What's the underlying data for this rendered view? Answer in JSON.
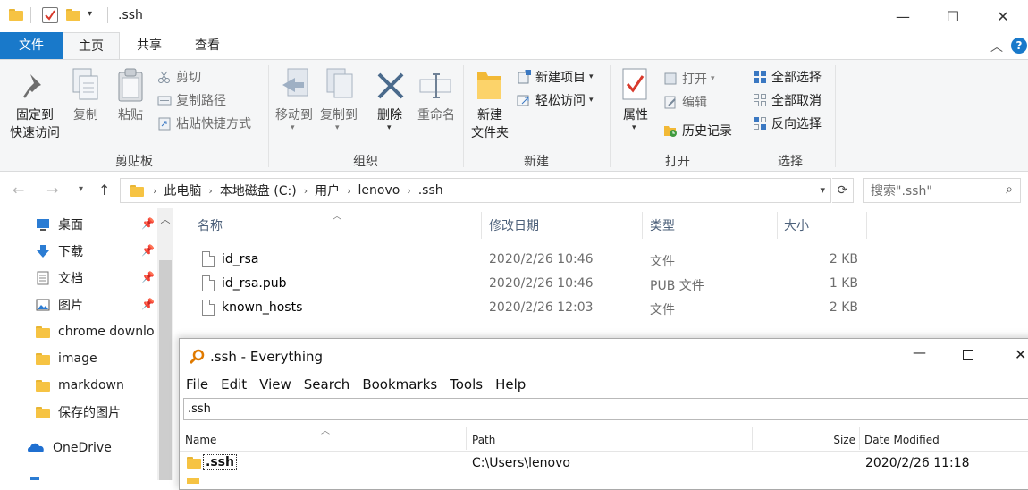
{
  "window": {
    "title": ".ssh",
    "controls": {
      "minimize": "—",
      "maximize": "☐",
      "close": "✕"
    }
  },
  "ribbon_tabs": [
    "文件",
    "主页",
    "共享",
    "查看"
  ],
  "ribbon": {
    "clipboard": {
      "pin_label": "固定到\n快速访问",
      "copy_label": "复制",
      "paste_label": "粘贴",
      "cut_label": "剪切",
      "copy_path_label": "复制路径",
      "paste_shortcut_label": "粘贴快捷方式",
      "group_label": "剪贴板"
    },
    "organize": {
      "move_to_label": "移动到",
      "copy_to_label": "复制到",
      "delete_label": "删除",
      "rename_label": "重命名",
      "group_label": "组织"
    },
    "new": {
      "new_folder_label": "新建\n文件夹",
      "new_item_label": "新建项目",
      "easy_access_label": "轻松访问",
      "group_label": "新建"
    },
    "open": {
      "properties_label": "属性",
      "open_label": "打开",
      "edit_label": "编辑",
      "history_label": "历史记录",
      "group_label": "打开"
    },
    "select": {
      "select_all_label": "全部选择",
      "select_none_label": "全部取消",
      "invert_label": "反向选择",
      "group_label": "选择"
    }
  },
  "address": {
    "breadcrumbs": [
      "此电脑",
      "本地磁盘 (C:)",
      "用户",
      "lenovo",
      ".ssh"
    ],
    "search_placeholder": "搜索\".ssh\""
  },
  "nav_pane": [
    {
      "label": "桌面",
      "icon": "desktop-icon",
      "pinned": true
    },
    {
      "label": "下载",
      "icon": "download-icon",
      "pinned": true
    },
    {
      "label": "文档",
      "icon": "documents-icon",
      "pinned": true
    },
    {
      "label": "图片",
      "icon": "pictures-icon",
      "pinned": true
    },
    {
      "label": "chrome downlo",
      "icon": "folder-icon",
      "pinned": false
    },
    {
      "label": "image",
      "icon": "folder-icon",
      "pinned": false
    },
    {
      "label": "markdown",
      "icon": "folder-icon",
      "pinned": false
    },
    {
      "label": "保存的图片",
      "icon": "folder-icon",
      "pinned": false
    },
    {
      "label": "OneDrive",
      "icon": "onedrive-icon",
      "pinned": false
    }
  ],
  "file_list": {
    "columns": [
      "名称",
      "修改日期",
      "类型",
      "大小"
    ],
    "rows": [
      {
        "name": "id_rsa",
        "modified": "2020/2/26 10:46",
        "type": "文件",
        "size": "2 KB"
      },
      {
        "name": "id_rsa.pub",
        "modified": "2020/2/26 10:46",
        "type": "PUB 文件",
        "size": "1 KB"
      },
      {
        "name": "known_hosts",
        "modified": "2020/2/26 12:03",
        "type": "文件",
        "size": "2 KB"
      }
    ]
  },
  "everything": {
    "title": ".ssh - Everything",
    "menu": [
      "File",
      "Edit",
      "View",
      "Search",
      "Bookmarks",
      "Tools",
      "Help"
    ],
    "search_value": ".ssh",
    "columns": [
      "Name",
      "Path",
      "Size",
      "Date Modified"
    ],
    "rows": [
      {
        "name": ".ssh",
        "path": "C:\\Users\\lenovo",
        "size": "",
        "modified": "2020/2/26 11:18"
      }
    ]
  }
}
